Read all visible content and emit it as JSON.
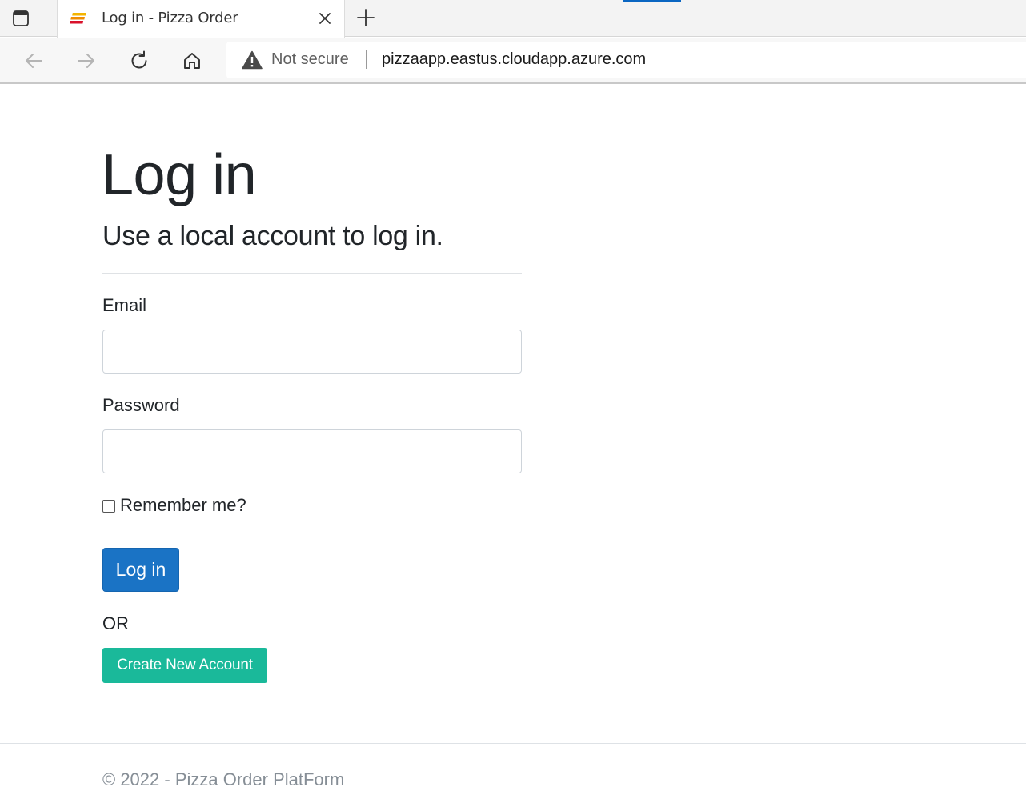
{
  "browser": {
    "tab_title": "Log in - Pizza Order",
    "security_label": "Not secure",
    "url": "pizzaapp.eastus.cloudapp.azure.com",
    "icons": [
      "tab-actions-icon",
      "favicon-icon",
      "close-icon",
      "plus-icon",
      "back-arrow-icon",
      "forward-arrow-icon",
      "refresh-icon",
      "home-icon",
      "warning-icon"
    ]
  },
  "page": {
    "title": "Log in",
    "subtitle": "Use a local account to log in.",
    "email_label": "Email",
    "email_value": "",
    "password_label": "Password",
    "password_value": "",
    "remember_label": "Remember me?",
    "remember_checked": false,
    "login_button": "Log in",
    "or_text": "OR",
    "create_account_button": "Create New Account"
  },
  "footer": {
    "text": "© 2022 - Pizza Order PlatForm"
  },
  "colors": {
    "primary_button": "#1a73c5",
    "create_button": "#1ab99a",
    "footer_text": "#868e96"
  }
}
